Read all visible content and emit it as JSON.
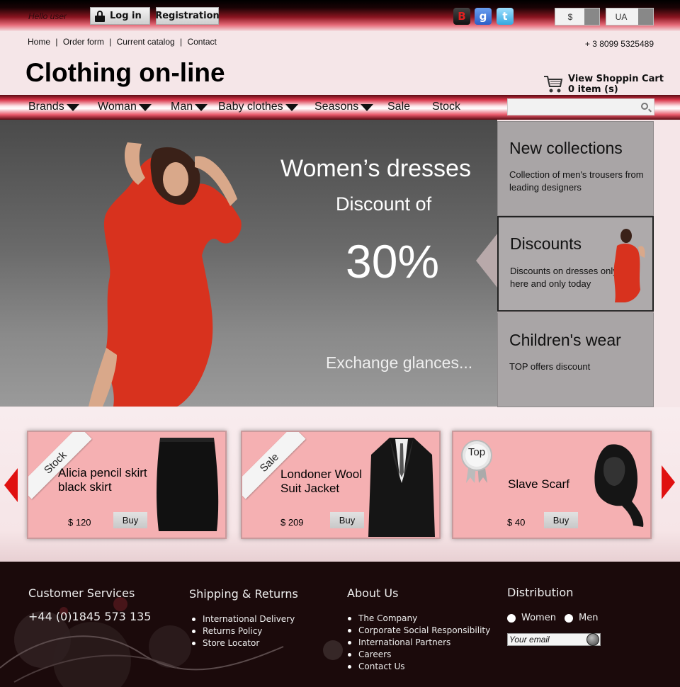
{
  "topbar": {
    "greeting": "Hello user",
    "login_label": "Log in",
    "registration_label": "Registration",
    "social": {
      "b": "B",
      "g": "g",
      "t": "t"
    },
    "currency": "$",
    "language": "UA"
  },
  "header": {
    "links": [
      "Home",
      "Order form",
      "Current catalog",
      "Contact"
    ],
    "phone": "+ 3 8099 5325489",
    "logo": "Clothing on-line",
    "cart_title": "View Shoppin Cart",
    "cart_count": "0 item (s)"
  },
  "nav": {
    "items": [
      "Brands",
      "Woman",
      "Man",
      "Baby clothes",
      "Seasons",
      "Sale",
      "Stock"
    ]
  },
  "hero": {
    "line1": "Women’s  dresses",
    "line2": "Discount of",
    "line3": "30%",
    "line4": "Exchange glances..."
  },
  "panels": [
    {
      "title": "New collections",
      "text": "Collection of men's trousers from leading designers"
    },
    {
      "title": "Discounts",
      "text": "Discounts on dresses only here and only today"
    },
    {
      "title": "Children's wear",
      "text": "TOP offers discount"
    }
  ],
  "products": [
    {
      "tag": "Stock",
      "name_line1": "Alicia pencil skirt",
      "name_line2": "black skirt",
      "price": "$ 120",
      "buy": "Buy"
    },
    {
      "tag": "Sale",
      "name_line1": "Londoner Wool",
      "name_line2": "Suit Jacket",
      "price": "$ 209",
      "buy": "Buy"
    },
    {
      "tag": "Top",
      "name_line1": "Slave Scarf",
      "name_line2": "",
      "price": "$ 40",
      "buy": "Buy"
    }
  ],
  "footer": {
    "customer_title": "Customer Services",
    "customer_phone": "+44 (0)1845 573 135",
    "shipping_title": "Shipping & Returns",
    "shipping_items": [
      "International Delivery",
      "Returns Policy",
      "Store Locator"
    ],
    "about_title": "About Us",
    "about_items": [
      "The Company",
      "Corporate Social Responsibility",
      "International Partners",
      "Careers",
      "Contact Us"
    ],
    "distribution_title": "Distribution",
    "radio_women": "Women",
    "radio_men": "Men",
    "email_placeholder": "Your email"
  },
  "colors": {
    "accent": "#e01010",
    "card": "#f5b0b2",
    "footer": "#1b0a0b",
    "panel": "#a9a5a6"
  },
  "icons": [
    "lock-icon",
    "cart-icon",
    "search-icon",
    "arrow-left-icon",
    "arrow-right-icon",
    "submit-icon"
  ]
}
